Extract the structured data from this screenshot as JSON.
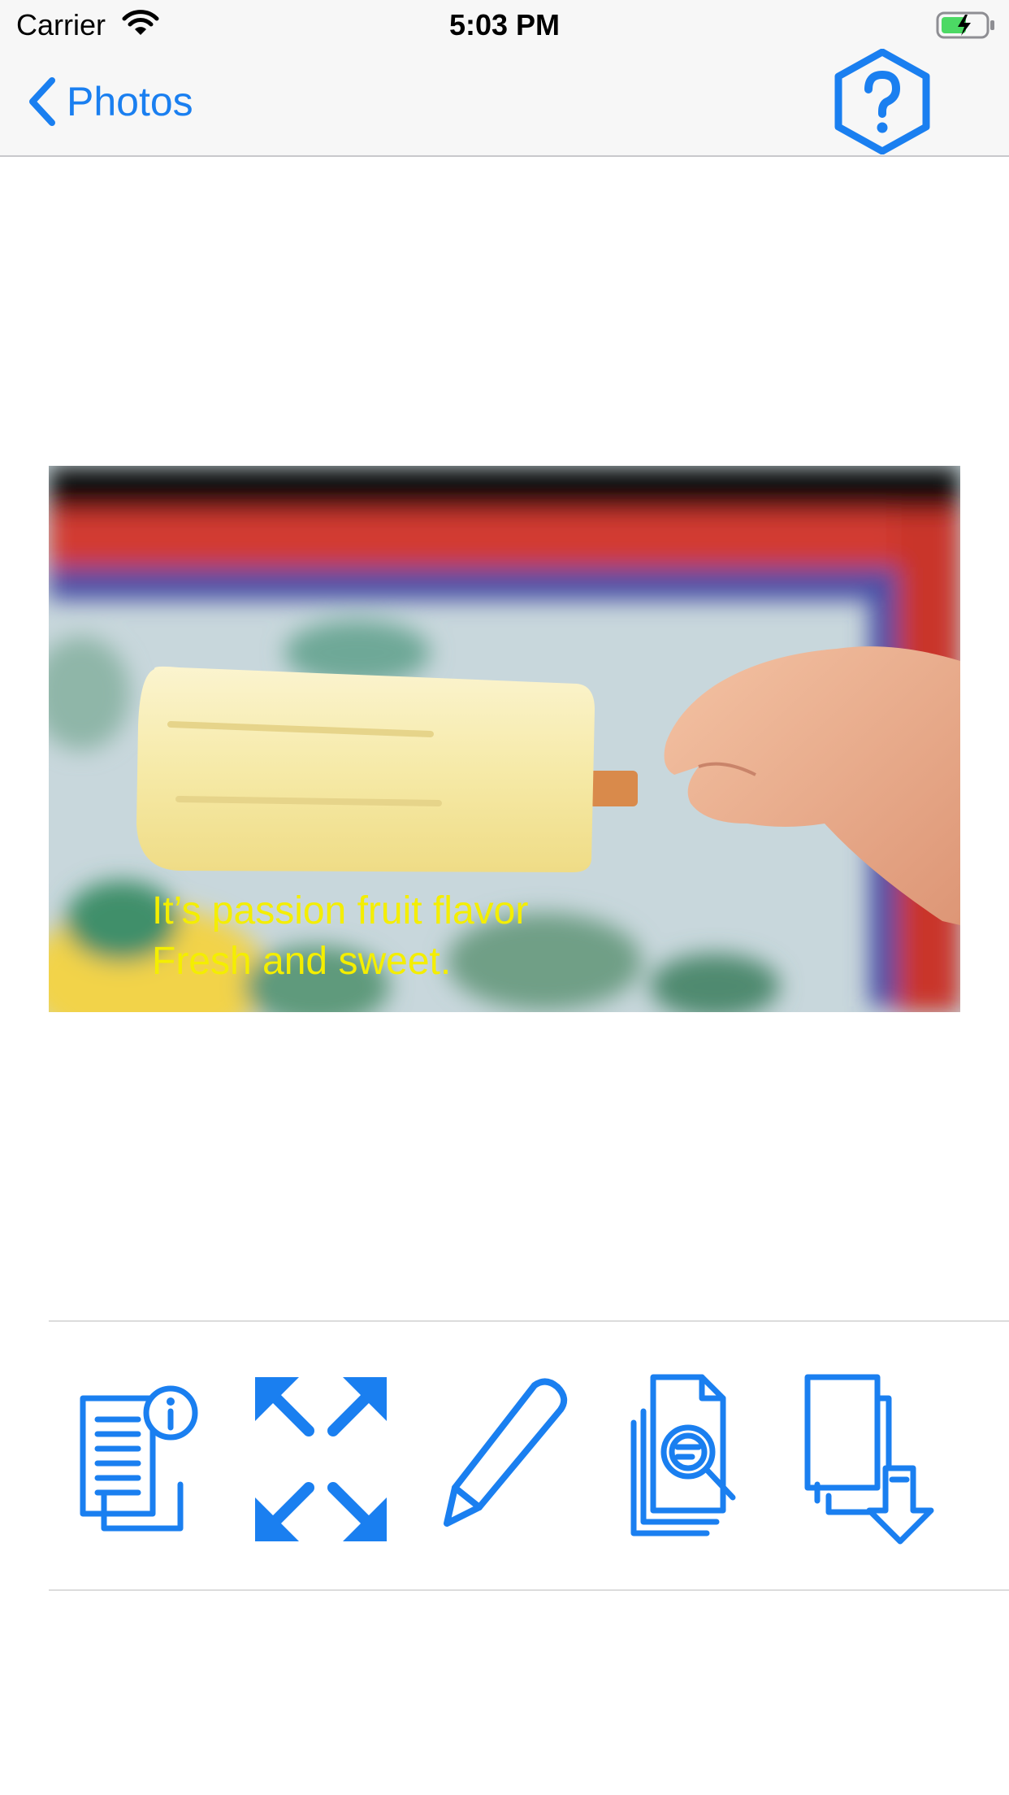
{
  "status_bar": {
    "carrier": "Carrier",
    "time": "5:03 PM",
    "icons": [
      "wifi-icon",
      "battery-charging-icon"
    ]
  },
  "nav_bar": {
    "back_label": "Photos",
    "back_icon": "chevron-left-icon",
    "help_icon": "hexagon-question-icon"
  },
  "photo": {
    "caption_line1": "It’s passion fruit flavor",
    "caption_line2": "Fresh and sweet."
  },
  "toolbar": {
    "items": [
      "info-document-icon",
      "expand-arrows-icon",
      "pencil-icon",
      "document-search-icon",
      "document-export-icon"
    ]
  },
  "colors": {
    "accent": "#1a7ff0",
    "caption": "#f4ee00",
    "bar_background": "#f7f7f7"
  }
}
